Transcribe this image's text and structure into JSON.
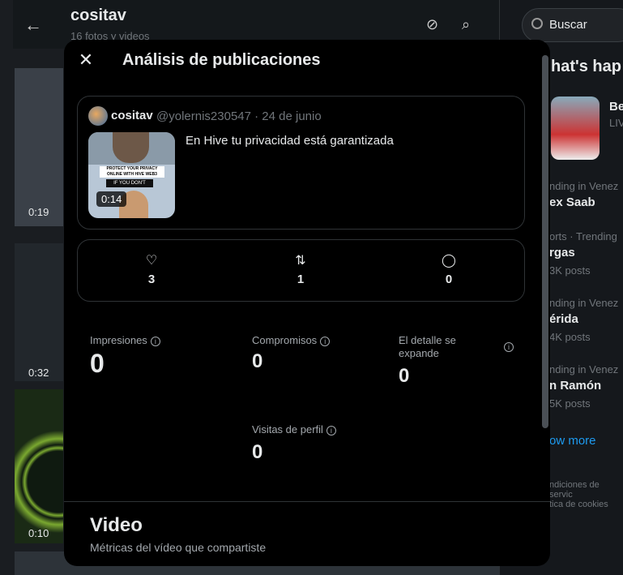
{
  "background": {
    "title": "cositav",
    "subtitle": "16 fotos y videos",
    "search_placeholder": "Buscar",
    "whats_happening": "hat's hap",
    "thumb_durations": [
      "0:19",
      "0:32",
      "0:10"
    ],
    "trends": [
      {
        "meta": "nding in Venez",
        "name": "ex Saab",
        "posts": ""
      },
      {
        "meta": "orts · Trending",
        "name": "rgas",
        "posts": "3K posts"
      },
      {
        "meta": "nding in Venez",
        "name": "érida",
        "posts": "4K posts"
      },
      {
        "meta": "nding in Venez",
        "name": "n Ramón",
        "posts": "5K posts"
      }
    ],
    "featured": {
      "name": "Be",
      "meta": "LIV"
    },
    "show_more": "ow more",
    "footer": [
      "ndiciones de servic",
      "tica de cookies"
    ]
  },
  "modal": {
    "title": "Análisis de publicaciones",
    "post": {
      "name": "cositav",
      "handle_date": "@yolernis230547 · 24 de junio",
      "text": "En Hive tu privacidad está garantizada",
      "duration": "0:14",
      "thumb_banner": "PROTECT YOUR PRIVACY ONLINE WITH HIVE WEB3",
      "thumb_band": "IF YOU DON'T"
    },
    "stats": {
      "likes": "3",
      "reposts": "1",
      "replies": "0"
    },
    "metrics": {
      "impressions_label": "Impresiones",
      "impressions": "0",
      "engagements_label": "Compromisos",
      "engagements": "0",
      "detail_label": "El detalle se expande",
      "detail": "0",
      "profile_label": "Visitas de perfil",
      "profile": "0"
    },
    "video": {
      "title": "Video",
      "subtitle": "Métricas del vídeo que compartiste"
    }
  }
}
